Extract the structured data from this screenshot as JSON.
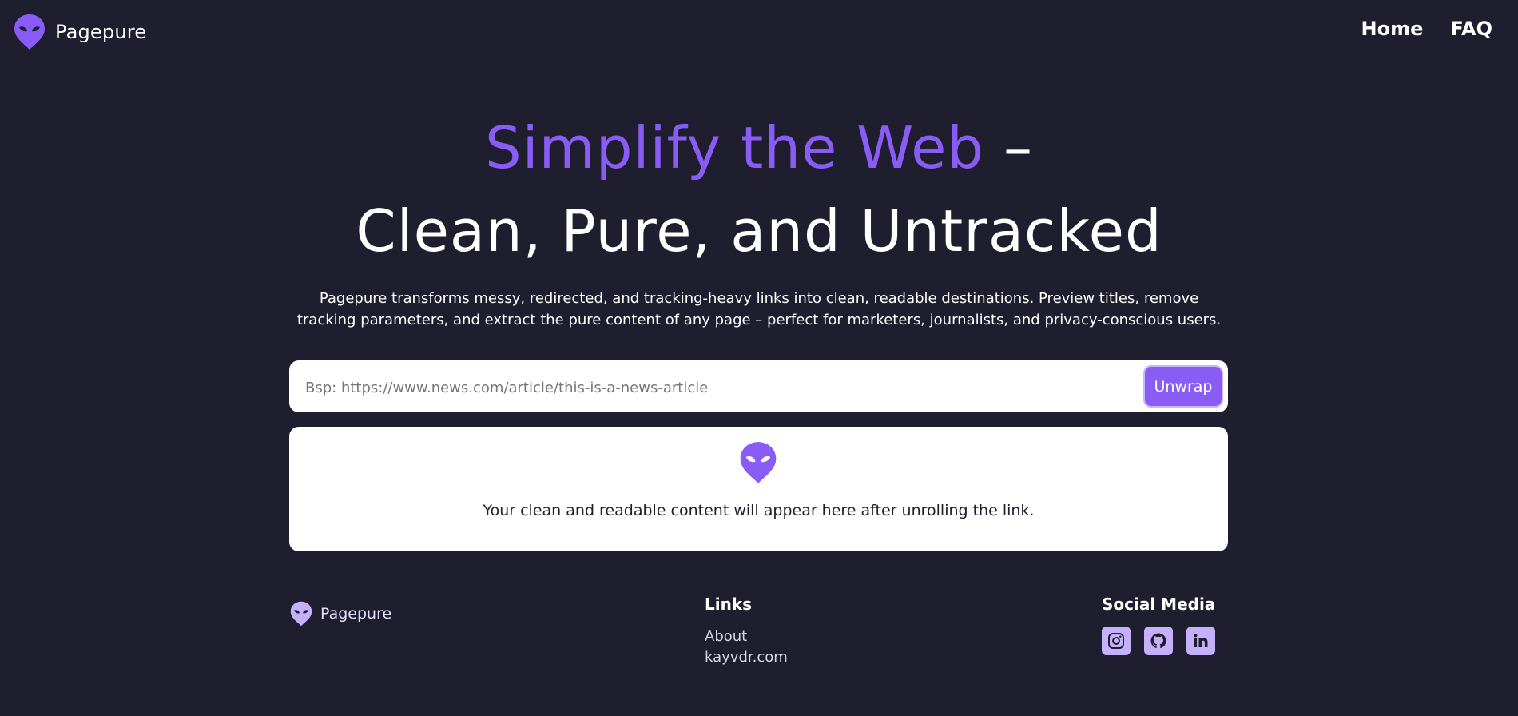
{
  "header": {
    "brand_name": "Pagepure",
    "nav": [
      {
        "label": "Home"
      },
      {
        "label": "FAQ"
      }
    ]
  },
  "hero": {
    "title_accent": "Simplify the Web",
    "title_dash": " –",
    "title_line2": "Clean, Pure, and Untracked",
    "description": "Pagepure transforms messy, redirected, and tracking-heavy links into clean, readable destinations. Preview titles, remove tracking parameters, and extract the pure content of any page – perfect for marketers, journalists, and privacy-conscious users."
  },
  "url_form": {
    "placeholder": "Bsp: https://www.news.com/article/this-is-a-news-article",
    "value": "",
    "button_label": "Unwrap"
  },
  "output": {
    "icon": "alien-icon",
    "message": "Your clean and readable content will appear here after unrolling the link."
  },
  "footer": {
    "brand_name": "Pagepure",
    "links_heading": "Links",
    "links": [
      {
        "label": "About"
      },
      {
        "label": "kayvdr.com"
      }
    ],
    "social_heading": "Social Media",
    "social": [
      {
        "icon": "instagram-icon"
      },
      {
        "icon": "github-icon"
      },
      {
        "icon": "linkedin-icon"
      }
    ]
  },
  "colors": {
    "background": "#1f1e2e",
    "accent": "#8a5cf6",
    "accent_light": "#c4b0fb",
    "card": "#ffffff"
  }
}
